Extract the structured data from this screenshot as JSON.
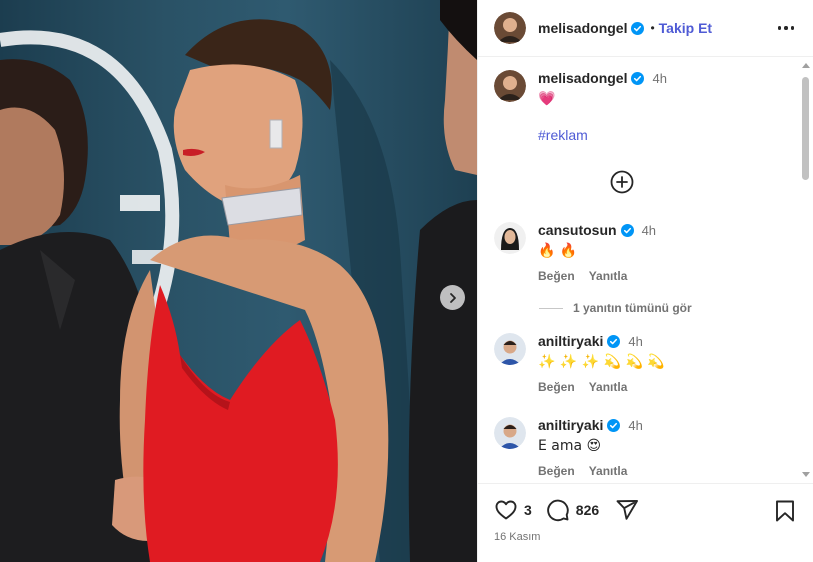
{
  "header": {
    "username": "melisadongel",
    "separator": "•",
    "follow_label": "Takip Et"
  },
  "caption": {
    "username": "melisadongel",
    "time": "4h",
    "text": "💗",
    "hashtag": "#reklam"
  },
  "comments": [
    {
      "username": "cansutosun",
      "time": "4h",
      "text": "🔥 🔥",
      "like_label": "Beğen",
      "reply_label": "Yanıtla"
    },
    {
      "username": "aniltiryaki",
      "time": "4h",
      "text": "✨ ✨ ✨ 💫 💫 💫",
      "like_label": "Beğen",
      "reply_label": "Yanıtla"
    },
    {
      "username": "aniltiryaki",
      "time": "4h",
      "text": "E ama 😍",
      "like_label": "Beğen",
      "reply_label": "Yanıtla"
    }
  ],
  "replies_label": "1 yanıtın tümünü gör",
  "footer": {
    "like_count": "3",
    "comment_count": "826",
    "date": "16 Kasım"
  },
  "colors": {
    "accent": "#4f5bd5",
    "verified": "#0095f6",
    "secondary_text": "#737373",
    "dress": "#e01b22",
    "backdrop": "#2a5266"
  },
  "icons": [
    "more-icon",
    "verified-icon",
    "add-comment-icon",
    "heart-icon",
    "comment-icon",
    "share-icon",
    "bookmark-icon",
    "chevron-right-icon"
  ]
}
